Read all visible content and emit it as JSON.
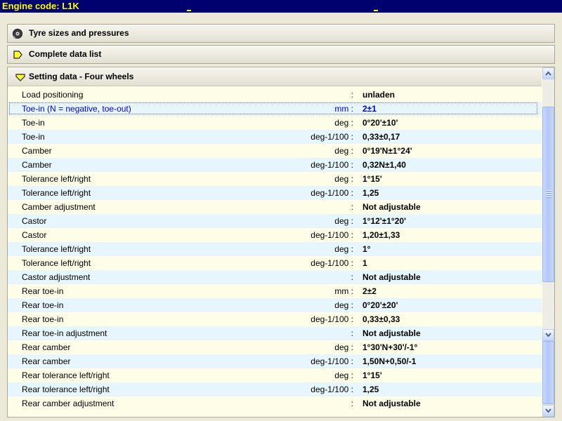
{
  "window": {
    "title": "Engine code: L1K"
  },
  "sections": {
    "tyres": {
      "label": "Tyre sizes and pressures",
      "icon": "tyre-icon"
    },
    "complete": {
      "label": "Complete data list",
      "icon": "arrow-right-icon"
    },
    "setting": {
      "label": "Setting data - Four wheels",
      "icon": "arrow-down-icon"
    }
  },
  "rows": [
    {
      "label": "Load positioning",
      "unit": ":",
      "value": "unladen"
    },
    {
      "label": "Toe-in (N = negative, toe-out)",
      "unit": "mm :",
      "value": "2±1",
      "selected": true
    },
    {
      "label": "Toe-in",
      "unit": "deg :",
      "value": "0°20'±10'"
    },
    {
      "label": "Toe-in",
      "unit": "deg-1/100 :",
      "value": "0,33±0,17"
    },
    {
      "label": "Camber",
      "unit": "deg :",
      "value": "0°19'N±1°24'"
    },
    {
      "label": "Camber",
      "unit": "deg-1/100 :",
      "value": "0,32N±1,40"
    },
    {
      "label": "Tolerance left/right",
      "unit": "deg :",
      "value": "1°15'"
    },
    {
      "label": "Tolerance left/right",
      "unit": "deg-1/100 :",
      "value": "1,25"
    },
    {
      "label": "Camber adjustment",
      "unit": ":",
      "value": "Not adjustable"
    },
    {
      "label": "Castor",
      "unit": "deg :",
      "value": "1°12'±1°20'"
    },
    {
      "label": "Castor",
      "unit": "deg-1/100 :",
      "value": "1,20±1,33"
    },
    {
      "label": "Tolerance left/right",
      "unit": "deg :",
      "value": "1°"
    },
    {
      "label": "Tolerance left/right",
      "unit": "deg-1/100 :",
      "value": "1"
    },
    {
      "label": "Castor adjustment",
      "unit": ":",
      "value": "Not adjustable"
    },
    {
      "label": "Rear toe-in",
      "unit": "mm :",
      "value": "2±2"
    },
    {
      "label": "Rear toe-in",
      "unit": "deg :",
      "value": "0°20'±20'"
    },
    {
      "label": "Rear toe-in",
      "unit": "deg-1/100 :",
      "value": "0,33±0,33"
    },
    {
      "label": "Rear toe-in adjustment",
      "unit": ":",
      "value": "Not adjustable"
    },
    {
      "label": "Rear camber",
      "unit": "deg :",
      "value": "1°30'N+30'/-1°"
    },
    {
      "label": "Rear camber",
      "unit": "deg-1/100 :",
      "value": "1,50N+0,50/-1"
    },
    {
      "label": "Rear tolerance left/right",
      "unit": "deg :",
      "value": "1°15'"
    },
    {
      "label": "Rear tolerance left/right",
      "unit": "deg-1/100 :",
      "value": "1,25"
    },
    {
      "label": "Rear camber adjustment",
      "unit": ":",
      "value": "Not adjustable"
    }
  ],
  "colors": {
    "titlebar_bg": "#00006e",
    "titlebar_text": "#ffff00",
    "row_odd": "#fdfde8",
    "row_even": "#e6f6fc",
    "selected_text": "#0000cc"
  }
}
